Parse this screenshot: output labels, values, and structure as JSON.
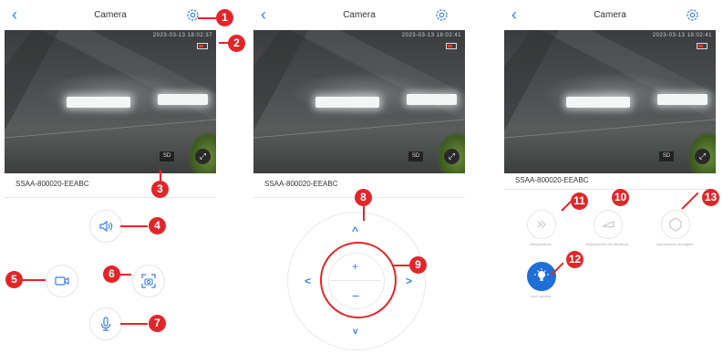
{
  "screens": [
    {
      "title": "Camera",
      "timestamp": "2023-03-13 18:02:37",
      "device_name": "SSAA-800020-EEABC",
      "sd_label": "SD"
    },
    {
      "title": "Camera",
      "timestamp": "2023-03-13 18:02:41",
      "device_name": "SSAA-800020-EEABC",
      "sd_label": "SD"
    },
    {
      "title": "Camera",
      "timestamp": "2023-03-13 18:02:41",
      "device_name": "SSAA-800020-EEABC",
      "sd_label": "SD"
    }
  ],
  "icons": {
    "back": "chevron-left-icon",
    "settings": "gear-icon",
    "battery": "battery-icon",
    "fullscreen": "expand-icon",
    "speaker": "speaker-icon",
    "record": "video-camera-icon",
    "snapshot": "screenshot-camera-icon",
    "mic": "microphone-icon",
    "light": "light-bulb-icon"
  },
  "ptz": {
    "zoom_in": "+",
    "zoom_out": "−",
    "up": "^",
    "down": "v",
    "left": "<",
    "right": ">"
  },
  "functions": [
    {
      "label": "Spegnimento"
    },
    {
      "label": "Regolazione del rilevatore"
    },
    {
      "label": "Impostazioni immagine"
    },
    {
      "label": "Luce accesa"
    }
  ],
  "markers": [
    "1",
    "2",
    "3",
    "4",
    "5",
    "6",
    "7",
    "8",
    "9",
    "10",
    "11",
    "12",
    "13"
  ],
  "colors": {
    "accent": "#3a7fe0",
    "marker": "#e1262a",
    "light_active": "#1f6fd6"
  }
}
